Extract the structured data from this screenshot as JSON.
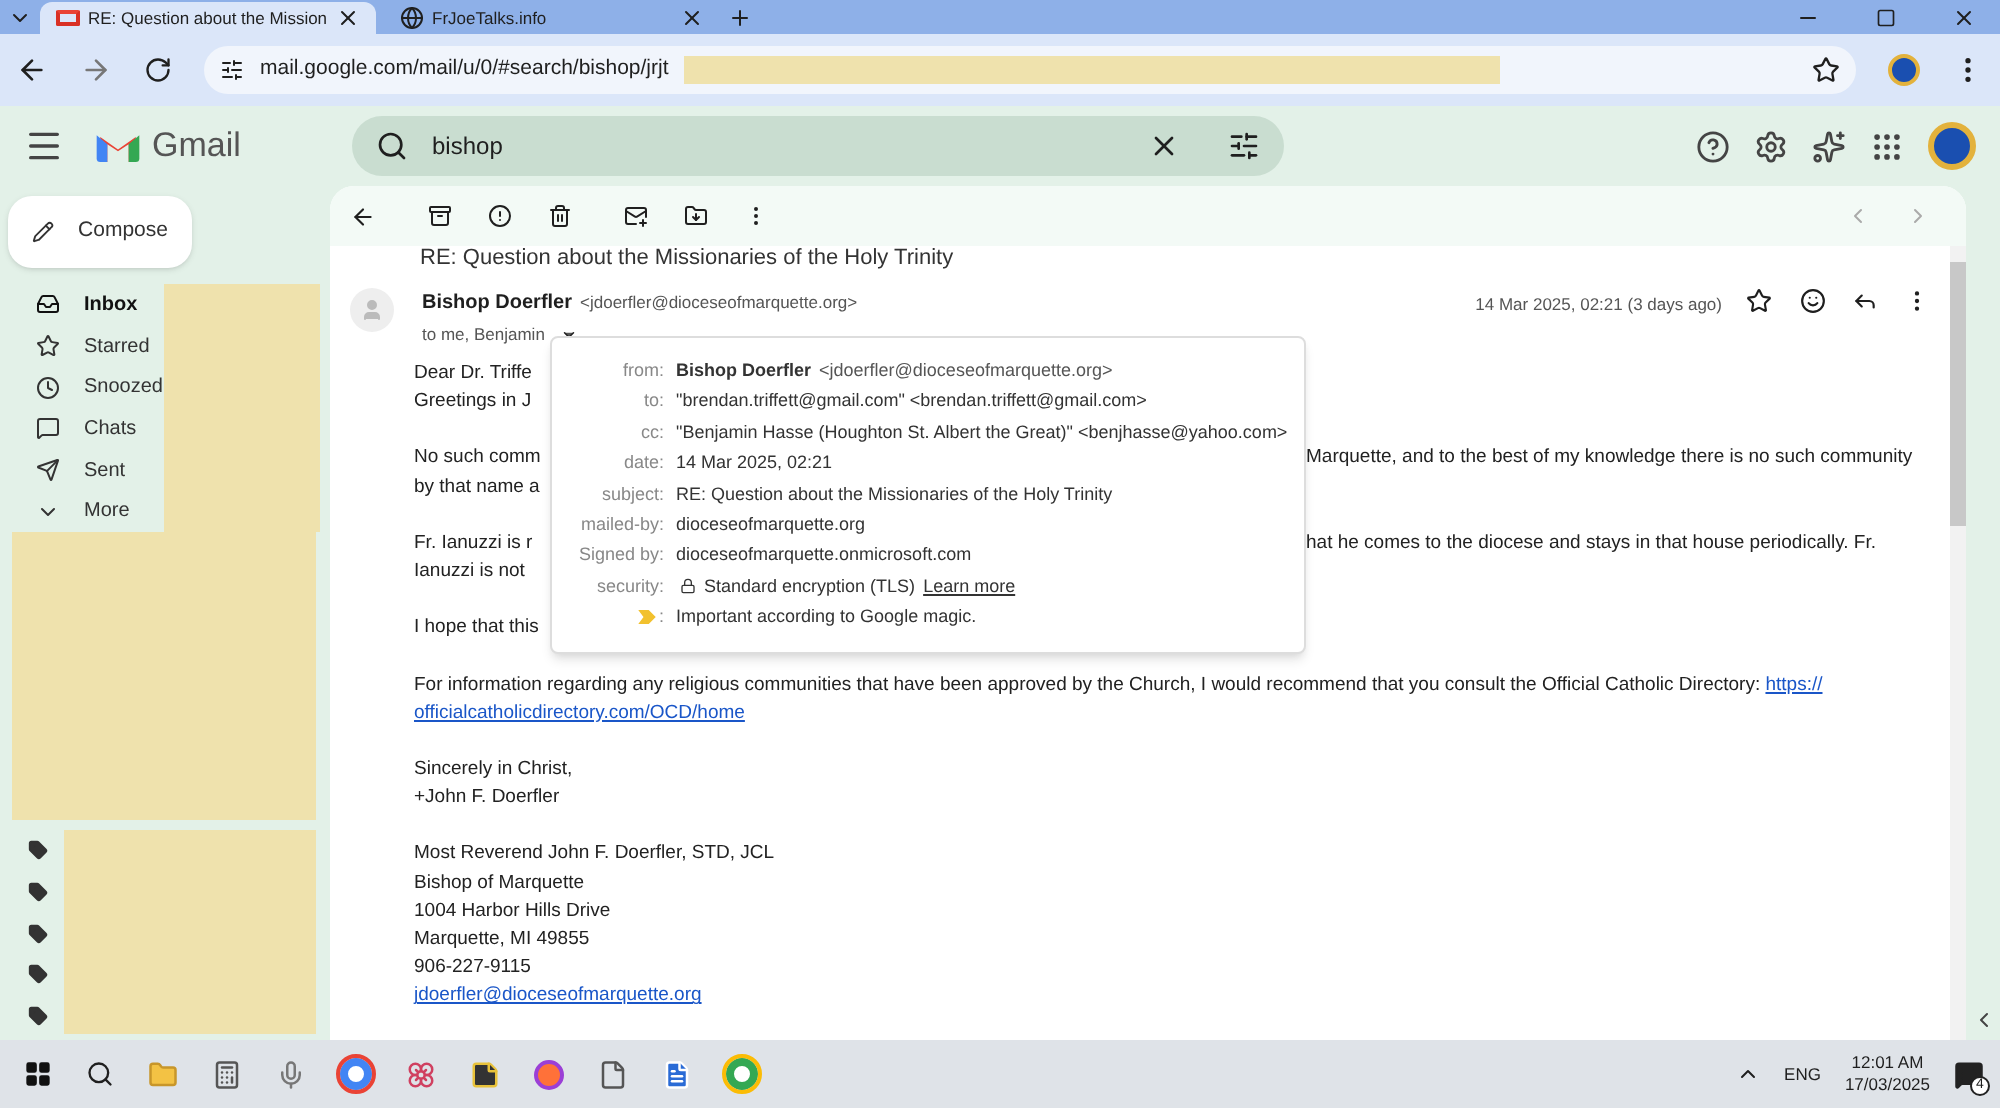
{
  "browser": {
    "tabs": [
      {
        "title": "RE: Question about the Mission",
        "selected": true
      },
      {
        "title": "FrJoeTalks.info",
        "selected": false
      }
    ],
    "url": "mail.google.com/mail/u/0/#search/bishop/jrjt"
  },
  "gmail": {
    "logo": "Gmail",
    "search": {
      "value": "bishop"
    }
  },
  "sidebar": {
    "compose": "Compose",
    "items": [
      {
        "label": "Inbox",
        "selected": true
      },
      {
        "label": "Starred",
        "selected": false
      },
      {
        "label": "Snoozed",
        "selected": false
      },
      {
        "label": "Chats",
        "selected": false
      },
      {
        "label": "Sent",
        "selected": false
      },
      {
        "label": "More",
        "selected": false
      }
    ]
  },
  "email": {
    "subject": "RE: Question about the Missionaries of the Holy Trinity",
    "sender_name": "Bishop Doerfler",
    "sender_email": "<jdoerfler@dioceseofmarquette.org>",
    "recipients": "to me, Benjamin",
    "date": "14 Mar 2025, 02:21 (3 days ago)",
    "covered_paragraphs": [
      [
        {
          "left": "Dear Dr. Triffe"
        },
        {
          "left": "Greetings in J"
        }
      ],
      [
        {
          "left": "No such comm",
          "right": "Marquette, and to the best of my knowledge there is no such community"
        },
        {
          "left": "by that name a"
        }
      ],
      [
        {
          "left": "Fr. Ianuzzi is r",
          "right": "hat he comes to the diocese and stays in that house periodically. Fr."
        },
        {
          "left": "Ianuzzi is not"
        }
      ],
      [
        {
          "left": "I hope that this"
        }
      ]
    ],
    "directory_text": "For information regarding any religious communities that have been approved by the Church, I would recommend that you consult the Official Catholic Directory:",
    "directory_link": [
      "https://",
      "officialcatholicdirectory.com/OCD/home"
    ],
    "closing": [
      "Sincerely in Christ,",
      "+John F. Doerfler"
    ],
    "signature": [
      "Most Reverend John F. Doerfler, STD, JCL",
      "Bishop of Marquette",
      "1004 Harbor Hills Drive",
      "Marquette, MI 49855",
      "906-227-9115"
    ],
    "signature_email": "jdoerfler@dioceseofmarquette.org"
  },
  "details": [
    {
      "label": "from:",
      "kind": "sender",
      "name": "Bishop Doerfler",
      "value": "<jdoerfler@dioceseofmarquette.org>"
    },
    {
      "label": "to:",
      "kind": "text",
      "value": "\"brendan.triffett@gmail.com\" <brendan.triffett@gmail.com>"
    },
    {
      "label": "cc:",
      "kind": "text",
      "value": "\"Benjamin Hasse (Houghton St. Albert the Great)\" <benjhasse@yahoo.com>"
    },
    {
      "label": "date:",
      "kind": "text",
      "value": "14 Mar 2025, 02:21"
    },
    {
      "label": "subject:",
      "kind": "text",
      "value": "RE: Question about the Missionaries of the Holy Trinity"
    },
    {
      "label": "mailed-by:",
      "kind": "text",
      "value": "dioceseofmarquette.org"
    },
    {
      "label": "Signed by:",
      "kind": "text",
      "value": "dioceseofmarquette.onmicrosoft.com"
    },
    {
      "label": "security:",
      "kind": "security",
      "value": "Standard encryption (TLS)",
      "link": "Learn more"
    },
    {
      "label": ":",
      "kind": "importance",
      "value": "Important according to Google magic."
    }
  ],
  "taskbar": {
    "language": "ENG",
    "time": "12:01 AM",
    "date": "17/03/2025",
    "notifications": "4"
  }
}
